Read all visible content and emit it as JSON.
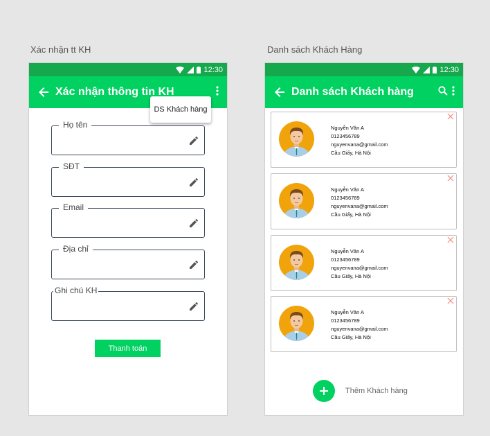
{
  "screens": {
    "left_label": "Xác nhận tt KH",
    "right_label": "Danh sách Khách Hàng"
  },
  "status_bar": {
    "time": "12:30"
  },
  "confirm_screen": {
    "title": "Xác nhận thông tin KH",
    "menu_item": "DS Khách hàng",
    "fields": [
      {
        "label": "Họ tên",
        "value": ""
      },
      {
        "label": "SĐT",
        "value": ""
      },
      {
        "label": "Email",
        "value": ""
      },
      {
        "label": "Địa chỉ",
        "value": ""
      },
      {
        "label": "Ghi chú KH",
        "value": ""
      }
    ],
    "pay_label": "Thanh toán"
  },
  "list_screen": {
    "title": "Danh sách Khách hàng",
    "customers": [
      {
        "name": "Nguyễn Văn A",
        "phone": "0123456789",
        "email": "nguyenvana@gmail.com",
        "address": "Cầu Giấy, Hà Nội"
      },
      {
        "name": "Nguyễn Văn A",
        "phone": "0123456789",
        "email": "nguyenvana@gmail.com",
        "address": "Cầu Giấy, Hà Nội"
      },
      {
        "name": "Nguyễn Văn A",
        "phone": "0123456789",
        "email": "nguyenvana@gmail.com",
        "address": "Cầu Giấy, Hà Nội"
      },
      {
        "name": "Nguyễn Văn A",
        "phone": "0123456789",
        "email": "nguyenvana@gmail.com",
        "address": "Cầu Giấy, Hà Nội"
      }
    ],
    "add_label": "Thêm Khách hàng"
  },
  "colors": {
    "status_bar": "#16a84c",
    "app_bar": "#00d160",
    "close": "#f28b82",
    "avatar_bg": "#f0a30a"
  },
  "icons": [
    "back-arrow-icon",
    "more-vert-icon",
    "search-icon",
    "edit-pencil-icon",
    "close-icon",
    "add-icon",
    "wifi-icon",
    "signal-icon",
    "battery-icon",
    "avatar-icon"
  ]
}
